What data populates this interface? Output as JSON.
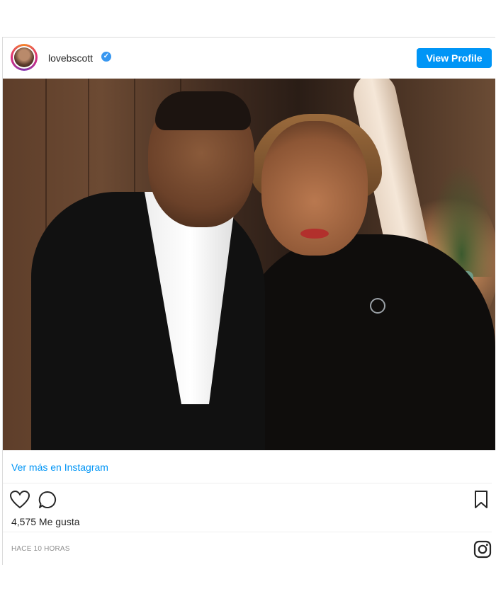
{
  "header": {
    "username": "lovebscott",
    "verified_symbol": "✓",
    "view_profile_label": "View Profile",
    "accent_color": "#0095f6"
  },
  "post": {
    "see_more_label": "Ver más en Instagram",
    "likes_text": "4,575 Me gusta",
    "timestamp": "HACE 10 HORAS"
  },
  "icons": [
    "heart-icon",
    "comment-icon",
    "bookmark-icon",
    "instagram-icon",
    "verified-badge-icon",
    "avatar"
  ]
}
